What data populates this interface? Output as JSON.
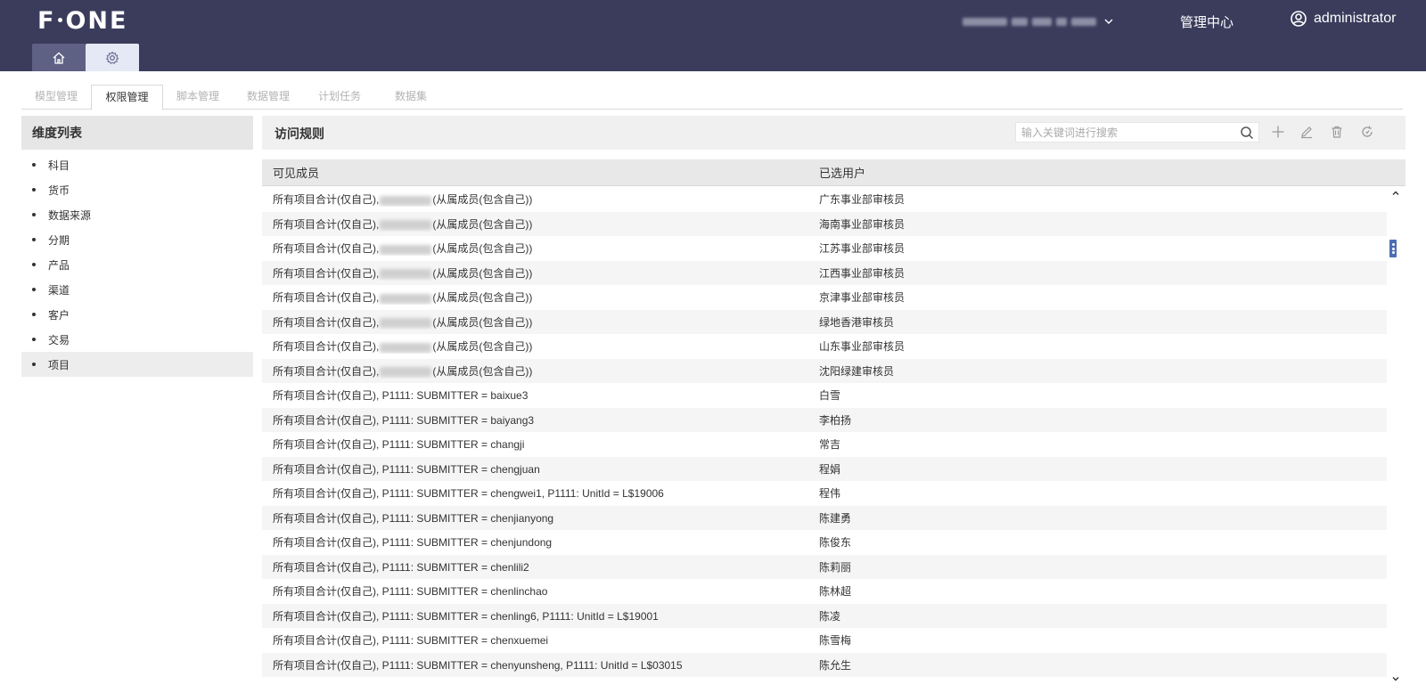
{
  "app": {
    "logo": "F",
    "logo_rest": "ONE",
    "management_center": "管理中心",
    "user_name": "administrator"
  },
  "module_tabs": [
    "模型管理",
    "权限管理",
    "脚本管理",
    "数据管理",
    "计划任务",
    "数据集"
  ],
  "left_panel": {
    "title": "维度列表",
    "items": [
      "科目",
      "货币",
      "数据来源",
      "分期",
      "产品",
      "渠道",
      "客户",
      "交易",
      "项目"
    ]
  },
  "right_panel": {
    "title": "访问规则",
    "search_placeholder": "输入关键词进行搜索",
    "columns": [
      "可见成员",
      "已选用户"
    ]
  },
  "rows": [
    {
      "prefix": "所有项目合计(仅自己),",
      "mid": "(从属成员(包含自己))",
      "user": "广东事业部审核员"
    },
    {
      "prefix": "所有项目合计(仅自己),",
      "mid": "(从属成员(包含自己))",
      "user": "海南事业部审核员"
    },
    {
      "prefix": "所有项目合计(仅自己),",
      "mid": "(从属成员(包含自己))",
      "user": "江苏事业部审核员"
    },
    {
      "prefix": "所有项目合计(仅自己),",
      "mid": "(从属成员(包含自己))",
      "user": "江西事业部审核员"
    },
    {
      "prefix": "所有项目合计(仅自己),",
      "mid": "(从属成员(包含自己))",
      "user": "京津事业部审核员"
    },
    {
      "prefix": "所有项目合计(仅自己),",
      "mid": "(从属成员(包含自己))",
      "user": "绿地香港审核员"
    },
    {
      "prefix": "所有项目合计(仅自己),",
      "mid": "(从属成员(包含自己))",
      "user": "山东事业部审核员"
    },
    {
      "prefix": "所有项目合计(仅自己),",
      "mid": "(从属成员(包含自己))",
      "user": "沈阳绿建审核员"
    },
    {
      "prefix": "所有项目合计(仅自己), P1111: SUBMITTER = baixue3",
      "mid": "",
      "user": "白雪"
    },
    {
      "prefix": "所有项目合计(仅自己), P1111: SUBMITTER = baiyang3",
      "mid": "",
      "user": "李柏扬"
    },
    {
      "prefix": "所有项目合计(仅自己), P1111: SUBMITTER = changji",
      "mid": "",
      "user": "常吉"
    },
    {
      "prefix": "所有项目合计(仅自己), P1111: SUBMITTER = chengjuan",
      "mid": "",
      "user": "程娟"
    },
    {
      "prefix": "所有项目合计(仅自己), P1111: SUBMITTER = chengwei1, P1111: UnitId = L$19006",
      "mid": "",
      "user": "程伟"
    },
    {
      "prefix": "所有项目合计(仅自己), P1111: SUBMITTER = chenjianyong",
      "mid": "",
      "user": "陈建勇"
    },
    {
      "prefix": "所有项目合计(仅自己), P1111: SUBMITTER = chenjundong",
      "mid": "",
      "user": "陈俊东"
    },
    {
      "prefix": "所有项目合计(仅自己), P1111: SUBMITTER = chenlili2",
      "mid": "",
      "user": "陈莉丽"
    },
    {
      "prefix": "所有项目合计(仅自己), P1111: SUBMITTER = chenlinchao",
      "mid": "",
      "user": "陈林超"
    },
    {
      "prefix": "所有项目合计(仅自己), P1111: SUBMITTER = chenling6, P1111: UnitId = L$19001",
      "mid": "",
      "user": "陈凌"
    },
    {
      "prefix": "所有项目合计(仅自己), P1111: SUBMITTER = chenxuemei",
      "mid": "",
      "user": "陈雪梅"
    },
    {
      "prefix": "所有项目合计(仅自己), P1111: SUBMITTER = chenyunsheng, P1111: UnitId = L$03015",
      "mid": "",
      "user": "陈允生"
    }
  ],
  "icons": {
    "home": "home-icon",
    "settings": "gear-icon",
    "user": "user-circle-icon",
    "search": "search-icon",
    "add": "plus-icon",
    "edit": "edit-icon",
    "delete": "trash-icon",
    "refresh": "refresh-icon"
  },
  "colors": {
    "topbar": "#3b3c5c",
    "accent": "#4a6fb3"
  }
}
